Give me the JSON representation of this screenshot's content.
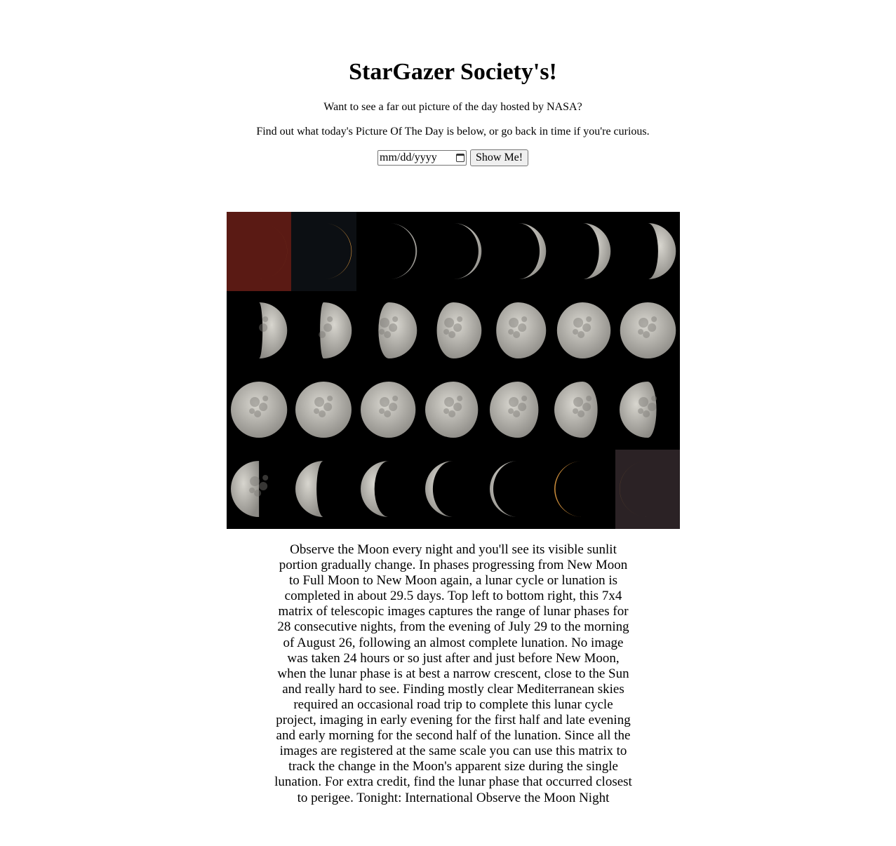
{
  "header": {
    "title": "StarGazer Society's!",
    "intro": "Want to see a far out picture of the day hosted by NASA?",
    "instructions": "Find out what today's Picture Of The Day is below, or go back in time if you're curious."
  },
  "form": {
    "date_placeholder": "mm/dd/yyyy",
    "submit_label": "Show Me!"
  },
  "apod": {
    "image_icon": "lunar-phase-matrix",
    "grid_columns": 7,
    "grid_rows": 4,
    "phases": [
      0.02,
      0.06,
      0.1,
      0.15,
      0.22,
      0.3,
      0.38,
      0.46,
      0.54,
      0.62,
      0.7,
      0.78,
      0.86,
      0.94,
      1.0,
      0.96,
      0.9,
      0.84,
      0.76,
      0.68,
      0.6,
      0.5,
      0.42,
      0.33,
      0.24,
      0.16,
      0.09,
      0.03
    ],
    "colors": {
      "red_cell": "#5a1a14",
      "dusk_cell": "#2b2225",
      "dark_cell": "#0c0f13",
      "moon_light": "#d8d6cf",
      "moon_dark": "#8c8a85",
      "crescent_orange": "#c88a3a"
    },
    "explanation": "Observe the Moon every night and you'll see its visible sunlit portion gradually change. In phases progressing from New Moon to Full Moon to New Moon again, a lunar cycle or lunation is completed in about 29.5 days. Top left to bottom right, this 7x4 matrix of telescopic images captures the range of lunar phases for 28 consecutive nights, from the evening of July 29 to the morning of August 26, following an almost complete lunation. No image was taken 24 hours or so just after and just before New Moon, when the lunar phase is at best a narrow crescent, close to the Sun and really hard to see. Finding mostly clear Mediterranean skies required an occasional road trip to complete this lunar cycle project, imaging in early evening for the first half and late evening and early morning for the second half of the lunation. Since all the images are registered at the same scale you can use this matrix to track the change in the Moon's apparent size during the single lunation. For extra credit, find the lunar phase that occurred closest to perigee. Tonight: International Observe the Moon Night"
  }
}
